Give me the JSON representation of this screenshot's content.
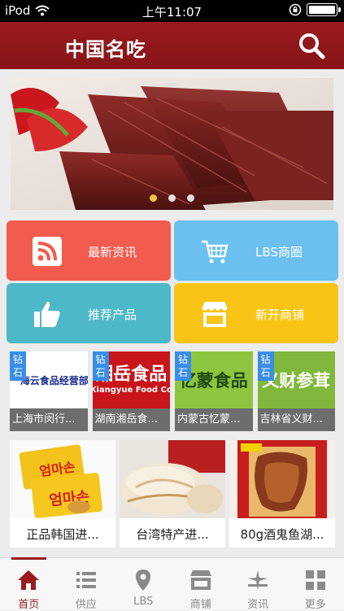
{
  "status_bar": {
    "carrier": "iPod",
    "time": "上午11:07"
  },
  "header": {
    "title": "中国名吃",
    "search_icon": "search-icon"
  },
  "banner": {
    "image": "braised-beef-jerky-photo",
    "dots": 3,
    "active_dot": 1
  },
  "tiles": [
    {
      "label": "最新资讯",
      "icon": "rss-icon",
      "color": "#f25c4e"
    },
    {
      "label": "LBS商圈",
      "icon": "cart-icon",
      "color": "#6bc0f0"
    },
    {
      "label": "推荐产品",
      "icon": "thumbs-up-icon",
      "color": "#4db8c7"
    },
    {
      "label": "新开商铺",
      "icon": "storefront-icon",
      "color": "#f9c415"
    }
  ],
  "brands": [
    {
      "tag": "钻石",
      "logo_text": "海云食品经营部",
      "caption": "上海市闵行..."
    },
    {
      "tag": "钻石",
      "logo_text": "湘岳食品",
      "logo_sub": "Xiangyue Food Co",
      "caption": "湖南湘岳食..."
    },
    {
      "tag": "钻石",
      "logo_text": "忆蒙食品",
      "caption": "内蒙古忆蒙..."
    },
    {
      "tag": "钻石",
      "logo_text": "义财参茸",
      "caption": "吉林省义财..."
    }
  ],
  "products": [
    {
      "name": "正品韩国进...",
      "image": "korean-snack-boxes"
    },
    {
      "name": "台湾特产进...",
      "image": "taiwan-pastry"
    },
    {
      "name": "80g酒鬼鱼湖...",
      "image": "dried-fish-package"
    }
  ],
  "tabs": [
    {
      "label": "首页",
      "icon": "home-icon",
      "active": true
    },
    {
      "label": "供应",
      "icon": "list-icon"
    },
    {
      "label": "LBS",
      "icon": "location-pin-icon"
    },
    {
      "label": "商铺",
      "icon": "shop-icon"
    },
    {
      "label": "资讯",
      "icon": "news-icon"
    },
    {
      "label": "更多",
      "icon": "grid-icon"
    }
  ]
}
